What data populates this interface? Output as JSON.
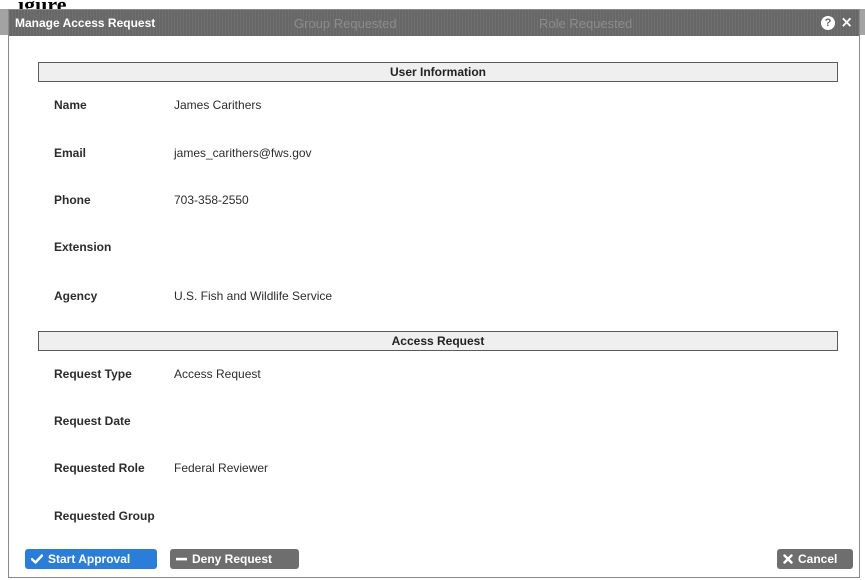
{
  "background": {
    "heading_fragment": "igure",
    "table_headers": [
      "Group Requested",
      "Role Requested"
    ]
  },
  "dialog": {
    "title": "Manage Access Request",
    "help_icon": "?",
    "close_icon": "×"
  },
  "user_info": {
    "header": "User Information",
    "fields": [
      {
        "label": "Name",
        "value": "James Carithers"
      },
      {
        "label": "Email",
        "value": "james_carithers@fws.gov"
      },
      {
        "label": "Phone",
        "value": "703-358-2550"
      },
      {
        "label": "Extension",
        "value": ""
      },
      {
        "label": "Agency",
        "value": "U.S. Fish and Wildlife Service"
      }
    ]
  },
  "access_request": {
    "header": "Access Request",
    "fields": [
      {
        "label": "Request Type",
        "value": "Access Request"
      },
      {
        "label": "Request Date",
        "value": ""
      },
      {
        "label": "Requested Role",
        "value": "Federal Reviewer"
      },
      {
        "label": "Requested Group",
        "value": ""
      }
    ]
  },
  "buttons": {
    "start_approval": "Start Approval",
    "deny_request": "Deny Request",
    "cancel": "Cancel"
  },
  "icons": {
    "checkmark": "check-icon",
    "minus": "minus-icon",
    "x": "close-icon",
    "help": "help-icon"
  },
  "colors": {
    "titlebar": "#676767",
    "primary_button": "#2b7ed8",
    "secondary_button": "#6e6e6e",
    "section_header_bg": "#efefef"
  }
}
